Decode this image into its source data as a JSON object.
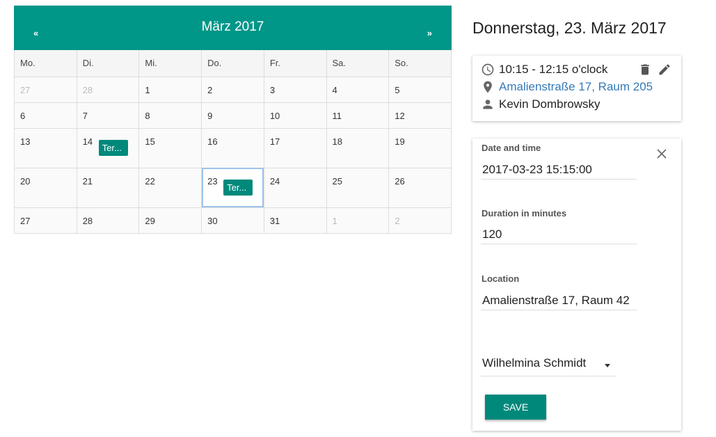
{
  "calendar": {
    "month_title": "März 2017",
    "prev_label": "«",
    "next_label": "»",
    "weekdays": [
      "Mo.",
      "Di.",
      "Mi.",
      "Do.",
      "Fr.",
      "Sa.",
      "So."
    ],
    "weeks": [
      [
        "27",
        "28",
        "1",
        "2",
        "3",
        "4",
        "5"
      ],
      [
        "6",
        "7",
        "8",
        "9",
        "10",
        "11",
        "12"
      ],
      [
        "13",
        "14",
        "15",
        "16",
        "17",
        "18",
        "19"
      ],
      [
        "20",
        "21",
        "22",
        "23",
        "24",
        "25",
        "26"
      ],
      [
        "27",
        "28",
        "29",
        "30",
        "31",
        "1",
        "2"
      ]
    ],
    "events": [
      {
        "label": "Ter..."
      },
      {
        "label": "Ter..."
      }
    ]
  },
  "day_title": "Donnerstag, 23. März 2017",
  "event": {
    "time": "10:15 - 12:15 o'clock",
    "location": "Amalienstraße 17, Raum 205",
    "person": "Kevin Dombrowsky"
  },
  "form": {
    "datetime_label": "Date and time",
    "datetime_value": "2017-03-23 15:15:00",
    "duration_label": "Duration in minutes",
    "duration_value": "120",
    "location_label": "Location",
    "location_value": "Amalienstraße 17, Raum 42",
    "person_selected": "Wilhelmina Schmidt",
    "save_label": "SAVE"
  },
  "colors": {
    "accent": "#009688",
    "button": "#00897b",
    "link": "#337ab7"
  }
}
